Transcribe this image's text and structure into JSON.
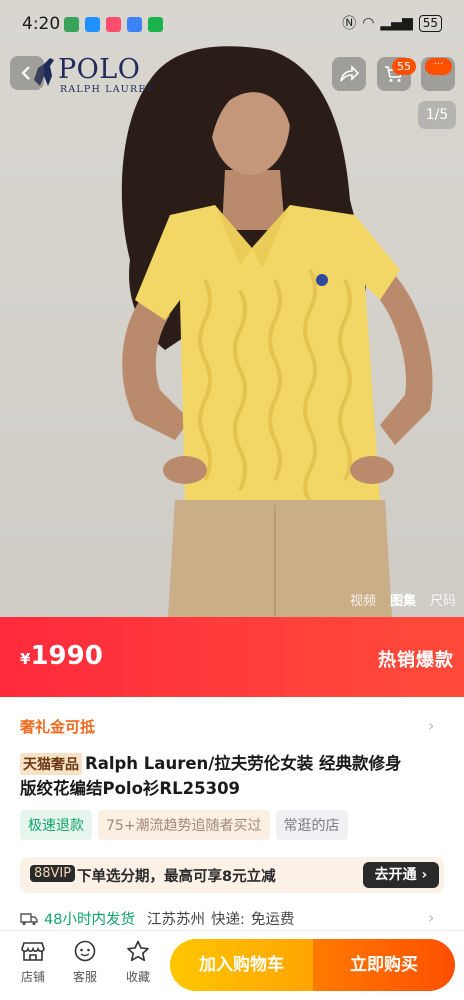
{
  "status_bar": {
    "time": "4:20",
    "battery": "55"
  },
  "brand": {
    "name": "POLO",
    "sub": "RALPH LAUREN"
  },
  "top_actions": {
    "cart_count": "55",
    "more_badge": "···"
  },
  "gallery": {
    "page_indicator": "1/5",
    "tabs": [
      "视频",
      "图集",
      "尺码"
    ],
    "active_tab": "图集"
  },
  "price": {
    "currency": "¥",
    "value": "1990",
    "label": "热销爆款"
  },
  "product": {
    "coupon": "奢礼金可抵",
    "tag": "天猫奢品",
    "title_line1": "Ralph Lauren/拉夫劳伦女装 经典款修身",
    "title_line2": "版绞花编结Polo衫RL25309",
    "chips": [
      "极速退款",
      "75+潮流趋势追随者买过",
      "常逛的店"
    ]
  },
  "vip": {
    "tag": "88VIP",
    "text": "下单选分期，最高可享8元立减",
    "button": "去开通 ›"
  },
  "shipping": {
    "fast": "48小时内发货",
    "location": "江苏苏州",
    "label": "快递:",
    "fee": "免运费"
  },
  "bottom_bar": {
    "tabs": [
      {
        "label": "店铺",
        "icon": "store-icon"
      },
      {
        "label": "客服",
        "icon": "customer-service-icon"
      },
      {
        "label": "收藏",
        "icon": "star-icon"
      }
    ],
    "add_to_cart": "加入购物车",
    "buy_now": "立即购买"
  },
  "colors": {
    "price_red": "#ff2a3c",
    "accent_orange": "#ff5000",
    "green": "#12a56b"
  }
}
